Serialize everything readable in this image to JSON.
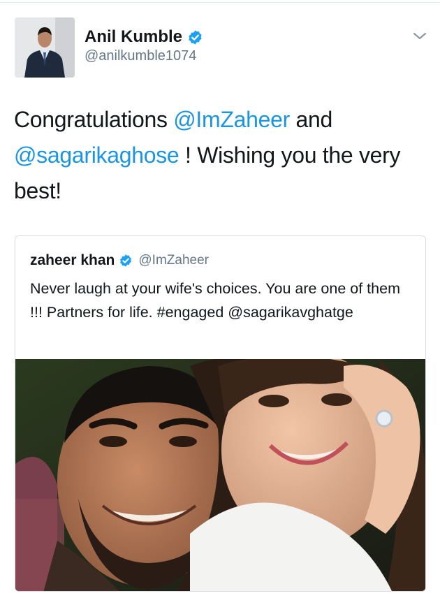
{
  "author": {
    "display_name": "Anil Kumble",
    "handle": "@anilkumble1074",
    "verified": true
  },
  "tweet": {
    "parts": [
      {
        "text": "Congratulations ",
        "type": "text"
      },
      {
        "text": "@ImZaheer",
        "type": "mention"
      },
      {
        "text": " and ",
        "type": "text"
      },
      {
        "text": "@sagarikaghose",
        "type": "mention"
      },
      {
        "text": " ! Wishing you the very best!",
        "type": "text"
      }
    ]
  },
  "quoted_tweet": {
    "display_name": "zaheer khan",
    "handle": "@ImZaheer",
    "verified": true,
    "text": "Never laugh at your wife's choices. You are one of them !!!  Partners for life. #engaged @sagarikavghatge",
    "photo": "selfie-photo"
  },
  "icons": {
    "verified": "verified-badge-icon",
    "menu": "chevron-down-icon"
  },
  "colors": {
    "link": "#1b95e0",
    "verified": "#1da1f2",
    "secondary_text": "#657786"
  }
}
